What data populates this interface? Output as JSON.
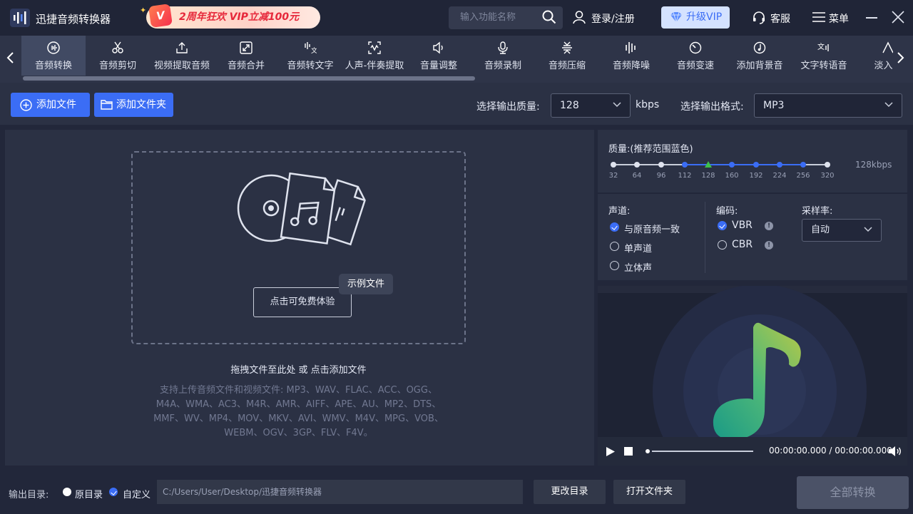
{
  "app": {
    "title": "迅捷音频转换器",
    "promo_badge": "V",
    "promo_text": "2周年狂欢 VIP立减100元"
  },
  "header": {
    "search_placeholder": "输入功能名称",
    "login_label": "登录/注册",
    "vip_label": "升级VIP",
    "service_label": "客服",
    "menu_label": "菜单"
  },
  "tools": [
    {
      "label": "音频转换",
      "icon": "audio-convert-icon",
      "active": true
    },
    {
      "label": "音频剪切",
      "icon": "scissors-icon"
    },
    {
      "label": "视频提取音频",
      "icon": "upload-icon"
    },
    {
      "label": "音频合并",
      "icon": "merge-icon"
    },
    {
      "label": "音频转文字",
      "icon": "audio-to-text-icon"
    },
    {
      "label": "人声-伴奏提取",
      "icon": "vocal-extract-icon"
    },
    {
      "label": "音量调整",
      "icon": "volume-icon"
    },
    {
      "label": "音频录制",
      "icon": "microphone-icon"
    },
    {
      "label": "音频压缩",
      "icon": "compress-icon"
    },
    {
      "label": "音频降噪",
      "icon": "denoise-icon"
    },
    {
      "label": "音频变速",
      "icon": "speed-icon"
    },
    {
      "label": "添加背景音",
      "icon": "background-music-icon"
    },
    {
      "label": "文字转语音",
      "icon": "text-to-speech-icon"
    },
    {
      "label": "淡入淡",
      "icon": "fade-icon"
    }
  ],
  "actions": {
    "add_file": "添加文件",
    "add_folder": "添加文件夹",
    "quality_label": "选择输出质量:",
    "quality_value": "128",
    "quality_unit": "kbps",
    "format_label": "选择输出格式:",
    "format_value": "MP3"
  },
  "dropzone": {
    "sample_button": "点击可免费体验",
    "sample_tag": "示例文件",
    "hint": "拖拽文件至此处 或 点击添加文件",
    "formats_line1": "支持上传音频文件和视频文件: MP3、WAV、FLAC、ACC、OGG、",
    "formats_line2": "M4A、WMA、AC3、M4R、AMR、AIFF、APE、AU、MP2、DTS、",
    "formats_line3": "MMF、WV、MP4、MOV、MKV、AVI、WMV、M4V、MPG、VOB、",
    "formats_line4": "WEBM、OGV、3GP、FLV、F4V。"
  },
  "quality": {
    "title": "质量:(推荐范围蓝色)",
    "ticks": [
      "32",
      "64",
      "96",
      "112",
      "128",
      "160",
      "192",
      "224",
      "256",
      "320"
    ],
    "selected": "128",
    "current": "128kbps"
  },
  "options": {
    "channel_label": "声道:",
    "channel_options": [
      "与原音频一致",
      "单声道",
      "立体声"
    ],
    "encoding_label": "编码:",
    "encoding_options": [
      "VBR",
      "CBR"
    ],
    "samplerate_label": "采样率:",
    "samplerate_value": "自动"
  },
  "player": {
    "time": "00:00:00.000 / 00:00:00.000",
    "progress": 0
  },
  "footer": {
    "output_label": "输出目录:",
    "option_original": "原目录",
    "option_custom": "自定义",
    "path": "C:/Users/User/Desktop/迅捷音频转换器",
    "change_dir": "更改目录",
    "open_folder": "打开文件夹",
    "convert_all": "全部转换"
  },
  "colors": {
    "accent": "#3b6df5",
    "background": "#22273a",
    "panel": "#2b3144",
    "promo_text": "#e6273a"
  }
}
